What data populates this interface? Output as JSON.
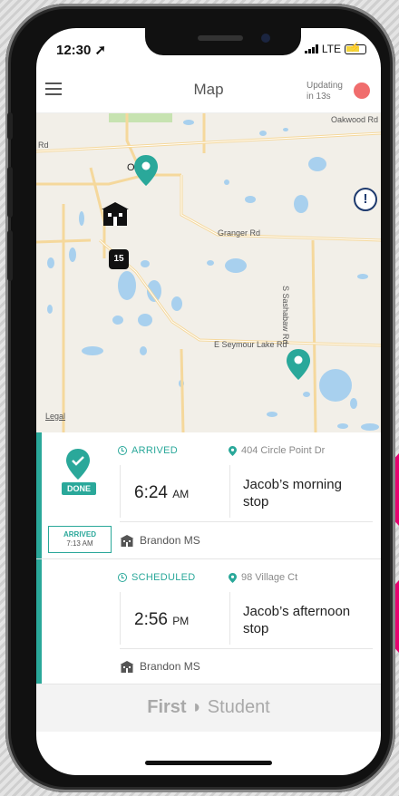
{
  "status_bar": {
    "time": "12:30",
    "network": "LTE"
  },
  "header": {
    "title": "Map",
    "updating": "Updating in 13s",
    "status_color": "#f06d6d"
  },
  "map": {
    "roads": [
      "Oakwood Rd",
      "Rd",
      "Granger Rd",
      "S Sashabaw Rd",
      "E Seymour Lake Rd"
    ],
    "town": "O   ville",
    "route_number": "15",
    "legal": "Legal"
  },
  "stops": [
    {
      "status": "ARRIVED",
      "address": "404 Circle Point Dr",
      "time": "6:24",
      "meridiem": "AM",
      "name": "Jacob’s morning stop",
      "school": "Brandon MS",
      "badge": "DONE",
      "arrived_label": "ARRIVED",
      "arrived_time": "7:13 AM"
    },
    {
      "status": "SCHEDULED",
      "address": "98 Village Ct",
      "time": "2:56",
      "meridiem": "PM",
      "name": "Jacob’s afternoon stop",
      "school": "Brandon MS"
    }
  ],
  "footer": {
    "brand_bold": "First",
    "brand_light": "Student"
  },
  "colors": {
    "accent": "#2aa89a",
    "highlight": "#e5006f",
    "info": "#1e3a6e"
  }
}
